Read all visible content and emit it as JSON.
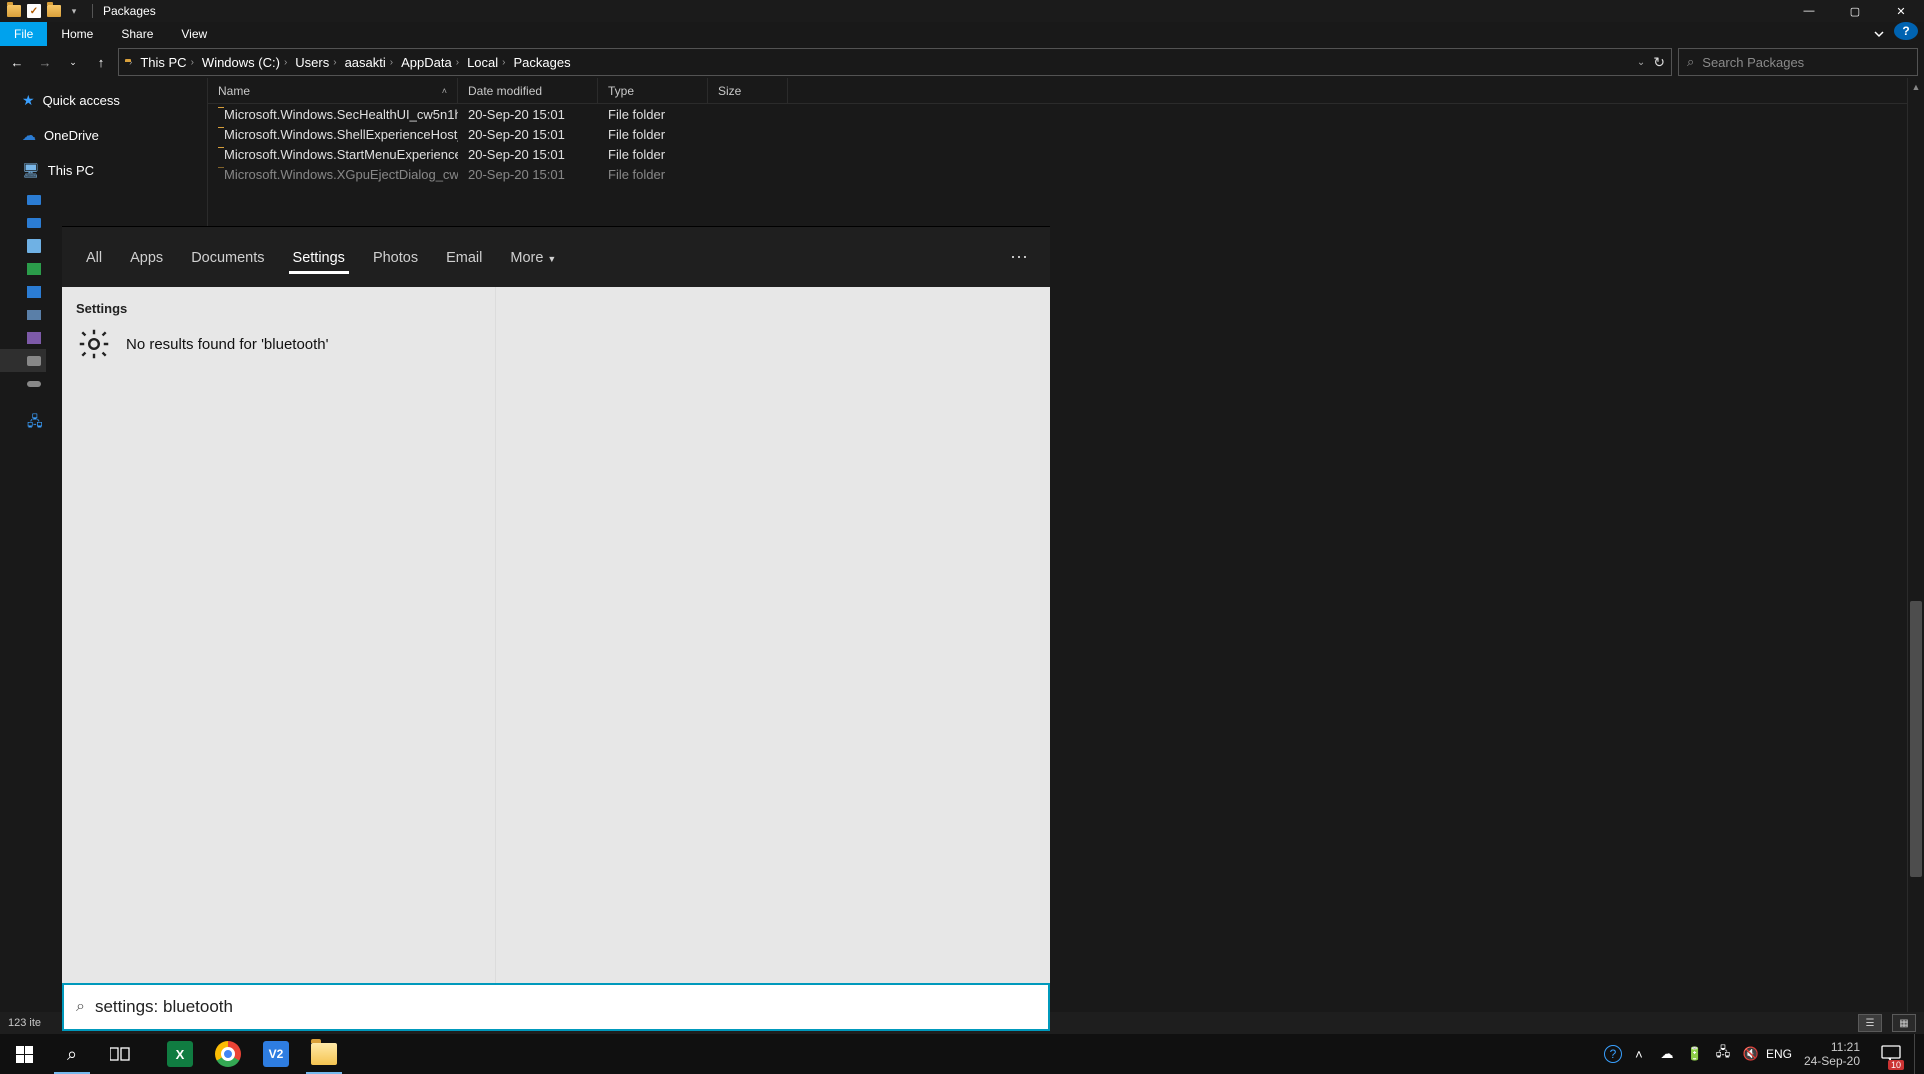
{
  "titlebar": {
    "title": "Packages"
  },
  "ribbon": {
    "file": "File",
    "home": "Home",
    "share": "Share",
    "view": "View"
  },
  "addrbar": {
    "crumbs": [
      "This PC",
      "Windows (C:)",
      "Users",
      "aasakti",
      "AppData",
      "Local",
      "Packages"
    ],
    "search_placeholder": "Search Packages"
  },
  "nav": {
    "quick": "Quick access",
    "onedrive": "OneDrive",
    "thispc": "This PC"
  },
  "columns": {
    "name": "Name",
    "date": "Date modified",
    "type": "Type",
    "size": "Size"
  },
  "rows": [
    {
      "name": "Microsoft.Windows.SecHealthUI_cw5n1h...",
      "date": "20-Sep-20 15:01",
      "type": "File folder"
    },
    {
      "name": "Microsoft.Windows.ShellExperienceHost_...",
      "date": "20-Sep-20 15:01",
      "type": "File folder"
    },
    {
      "name": "Microsoft.Windows.StartMenuExperience...",
      "date": "20-Sep-20 15:01",
      "type": "File folder"
    },
    {
      "name": "Microsoft.Windows.XGpuEjectDialog_cw...",
      "date": "20-Sep-20 15:01",
      "type": "File folder"
    }
  ],
  "statusbar": {
    "count": "123 ite"
  },
  "search": {
    "tabs": {
      "all": "All",
      "apps": "Apps",
      "docs": "Documents",
      "settings": "Settings",
      "photos": "Photos",
      "email": "Email",
      "more": "More"
    },
    "cat": "Settings",
    "noresult": "No results found for 'bluetooth'",
    "input_value": "settings: bluetooth"
  },
  "tray": {
    "lang": "ENG",
    "time": "11:21",
    "date": "24-Sep-20",
    "notif_count": "10"
  }
}
